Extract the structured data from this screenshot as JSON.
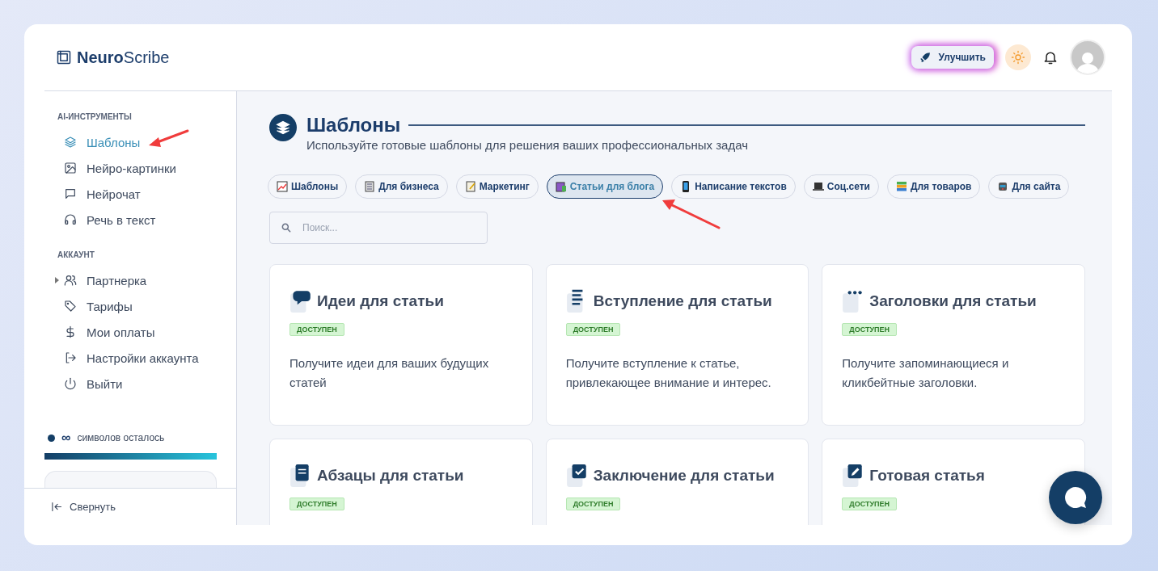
{
  "logo": {
    "text": "**Neuro**Scribe"
  },
  "header": {
    "upgrade_button": "Улучшить"
  },
  "sidebar": {
    "sections": [
      {
        "title": "AI-ИНСТРУМЕНТЫ",
        "items": [
          {
            "label": "Шаблоны",
            "kind": "link",
            "selected": true
          },
          {
            "label": "Нейро-картинки",
            "kind": "link",
            "selected": false
          },
          {
            "label": "Нейрочат",
            "kind": "link",
            "selected": false
          },
          {
            "label": "Речь в текст",
            "kind": "link",
            "selected": false
          }
        ]
      },
      {
        "title": "АККАУНТ",
        "items": [
          {
            "label": "Партнерка",
            "kind": "group",
            "expanded": false,
            "selected": false
          },
          {
            "label": "Тарифы",
            "kind": "link",
            "selected": false
          },
          {
            "label": "Мои оплаты",
            "kind": "link",
            "selected": false
          },
          {
            "label": "Настройки аккаунта",
            "kind": "link",
            "selected": false
          },
          {
            "label": "Выйти",
            "kind": "link",
            "selected": false
          }
        ]
      }
    ],
    "quota": {
      "value": "∞",
      "label": "символов осталось",
      "level": 1
    },
    "collapse_button": "Свернуть"
  },
  "main": {
    "title": "Шаблоны",
    "subtitle": "Используйте готовые шаблоны для решения ваших профессиональных задач",
    "categories": [
      {
        "label": "Шаблоны",
        "selected": false
      },
      {
        "label": "Для бизнеса",
        "selected": false
      },
      {
        "label": "Маркетинг",
        "selected": false
      },
      {
        "label": "Статьи для блога",
        "selected": true
      },
      {
        "label": "Написание текстов",
        "selected": false
      },
      {
        "label": "Соц.сети",
        "selected": false
      },
      {
        "label": "Для товаров",
        "selected": false
      },
      {
        "label": "Для сайта",
        "selected": false
      }
    ],
    "search": {
      "placeholder": "Поиск..."
    },
    "cards": [
      {
        "title": "Идеи для статьи",
        "badge": "ДОСТУПЕН",
        "description": "Получите идеи для ваших будущих статей"
      },
      {
        "title": "Вступление для статьи",
        "badge": "ДОСТУПЕН",
        "description": "Получите вступление к статье, привлекающее внимание и интерес."
      },
      {
        "title": "Заголовки для статьи",
        "badge": "ДОСТУПЕН",
        "description": "Получите запоминающиеся и кликбейтные заголовки."
      },
      {
        "title": "Абзацы для статьи",
        "badge": "ДОСТУПЕН"
      },
      {
        "title": "Заключение для статьи",
        "badge": "ДОСТУПЕН"
      },
      {
        "title": "Готовая статья",
        "badge": "ДОСТУПЕН"
      }
    ]
  }
}
